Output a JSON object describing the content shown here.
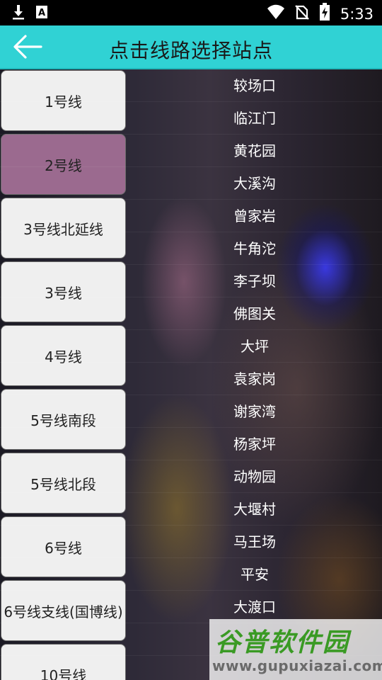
{
  "status_bar": {
    "time": "5:33",
    "icons": [
      "download-icon",
      "font-a-icon",
      "wifi-icon",
      "no-sim-icon",
      "battery-charging-icon"
    ]
  },
  "header": {
    "title": "点击线路选择站点",
    "back_icon": "back-arrow-icon",
    "color": "#30d2d4"
  },
  "lines": [
    {
      "label": "1号线",
      "selected": false
    },
    {
      "label": "2号线",
      "selected": true
    },
    {
      "label": "3号线北延线",
      "selected": false
    },
    {
      "label": "3号线",
      "selected": false
    },
    {
      "label": "4号线",
      "selected": false
    },
    {
      "label": "5号线南段",
      "selected": false
    },
    {
      "label": "5号线北段",
      "selected": false
    },
    {
      "label": "6号线",
      "selected": false
    },
    {
      "label": "6号线支线(国博线)",
      "selected": false
    },
    {
      "label": "10号线",
      "selected": false
    }
  ],
  "selected_color": "#9b6a8f",
  "stations": [
    "较场口",
    "临江门",
    "黄花园",
    "大溪沟",
    "曾家岩",
    "牛角沱",
    "李子坝",
    "佛图关",
    "大坪",
    "袁家岗",
    "谢家湾",
    "杨家坪",
    "动物园",
    "大堰村",
    "马王场",
    "平安",
    "大渡口"
  ],
  "watermark": {
    "logo": "谷普软件园",
    "url": "www.gupuxiazai.com"
  }
}
